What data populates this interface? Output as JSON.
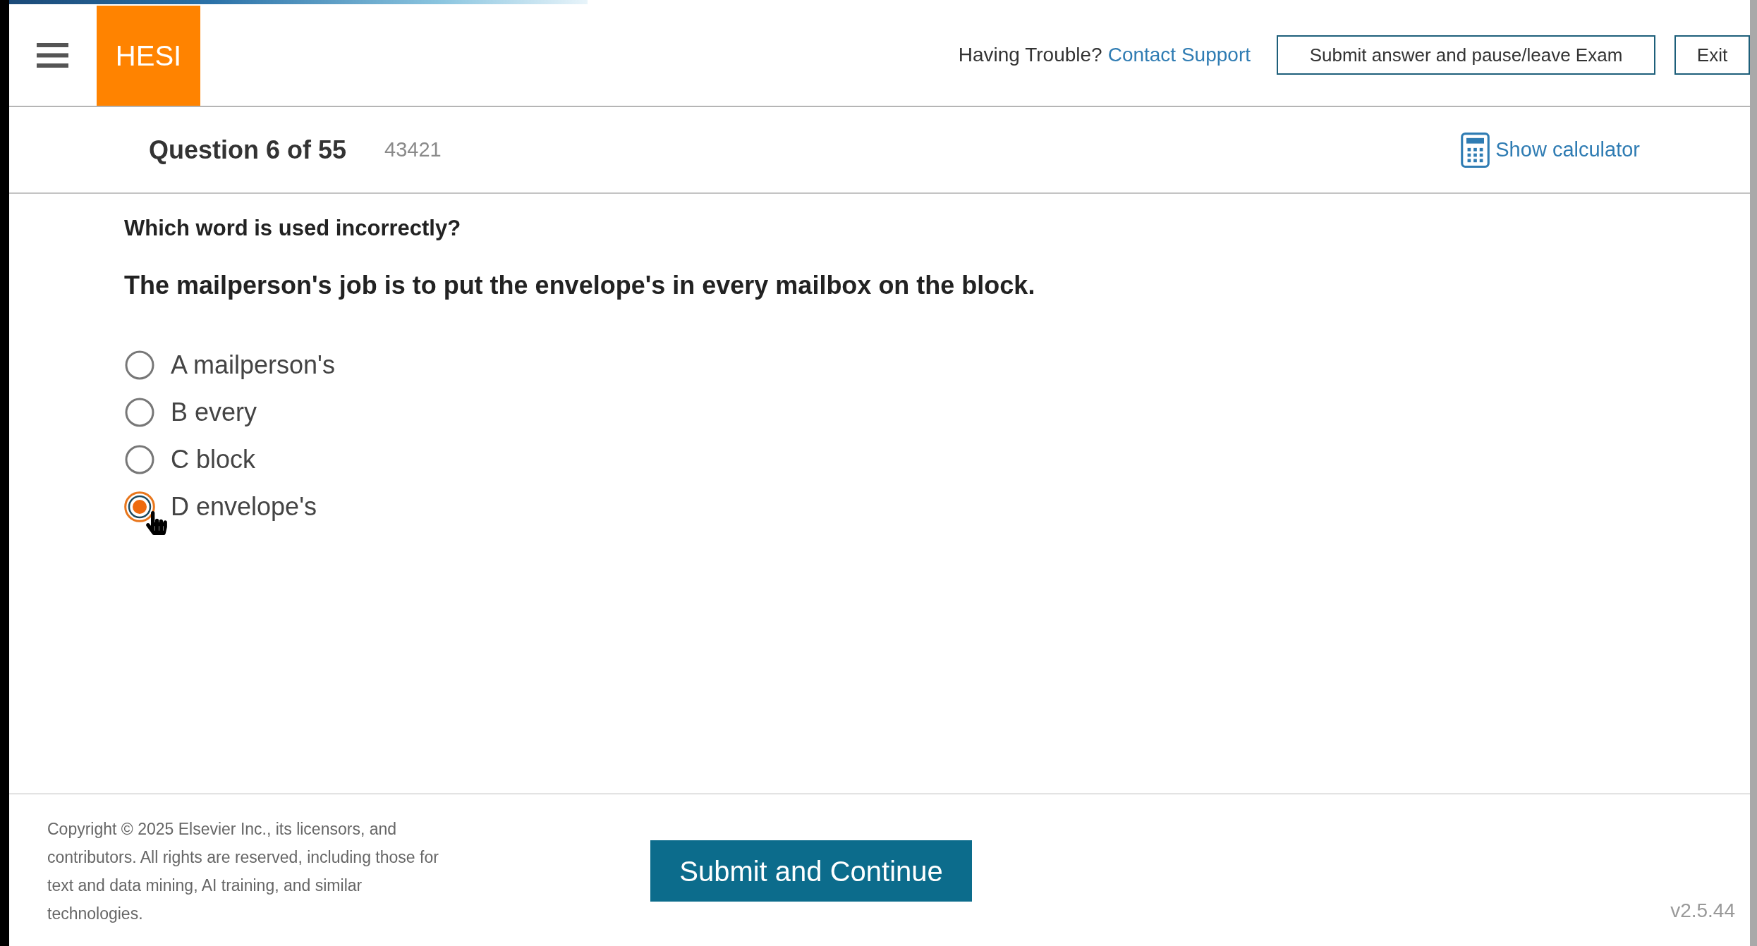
{
  "header": {
    "logo": "HESI",
    "help_text": "Having Trouble?",
    "help_link": "Contact Support",
    "buttons": [
      {
        "label": "Submit answer and pause/leave Exam"
      },
      {
        "label": "Exit"
      }
    ]
  },
  "question_bar": {
    "title": "Question 6 of 55",
    "code": "43421",
    "calculator_link": "Show calculator"
  },
  "question": {
    "prompt": "Which word is used incorrectly?",
    "sentence": "The mailperson's job is to put the envelope's in every mailbox on the block.",
    "options": [
      {
        "label": "A mailperson's",
        "selected": false
      },
      {
        "label": "B every",
        "selected": false
      },
      {
        "label": "C block",
        "selected": false
      },
      {
        "label": "D envelope's",
        "selected": true
      }
    ]
  },
  "footer": {
    "copyright_lines": [
      "Copyright © 2025 Elsevier Inc., its licensors, and",
      "contributors. All rights are reserved, including those for",
      "text and data mining, AI training, and similar",
      "technologies."
    ],
    "submit_button": "Submit and Continue",
    "version": "v2.5.44"
  }
}
